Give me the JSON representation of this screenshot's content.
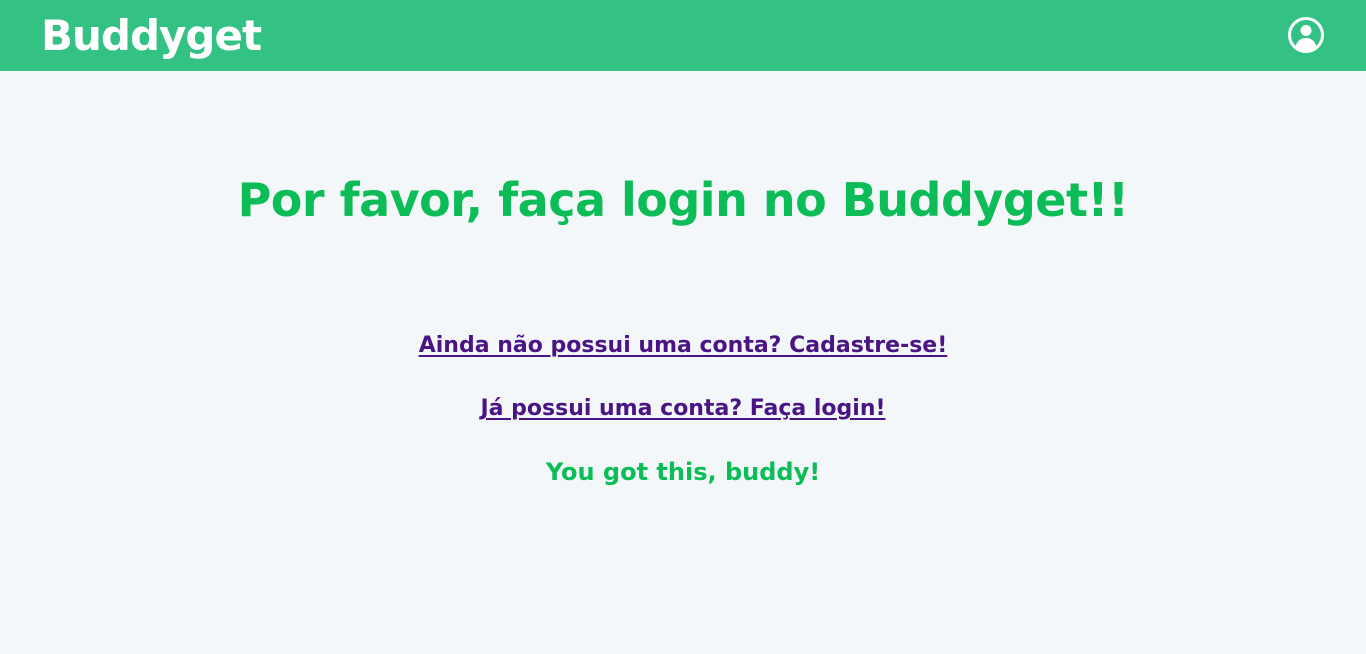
{
  "header": {
    "brand": "Buddyget",
    "user_icon": "user-circle-icon",
    "background_color": "#33c184"
  },
  "main": {
    "heading": "Por favor, faça login no Buddyget!!",
    "register_link": "Ainda não possui uma conta? Cadastre-se!",
    "login_link": "Já possui uma conta? Faça login!",
    "tagline": "You got this, buddy!",
    "heading_color": "#0cbc56",
    "link_color": "#4a1485",
    "background_color": "#f3f7fa"
  }
}
